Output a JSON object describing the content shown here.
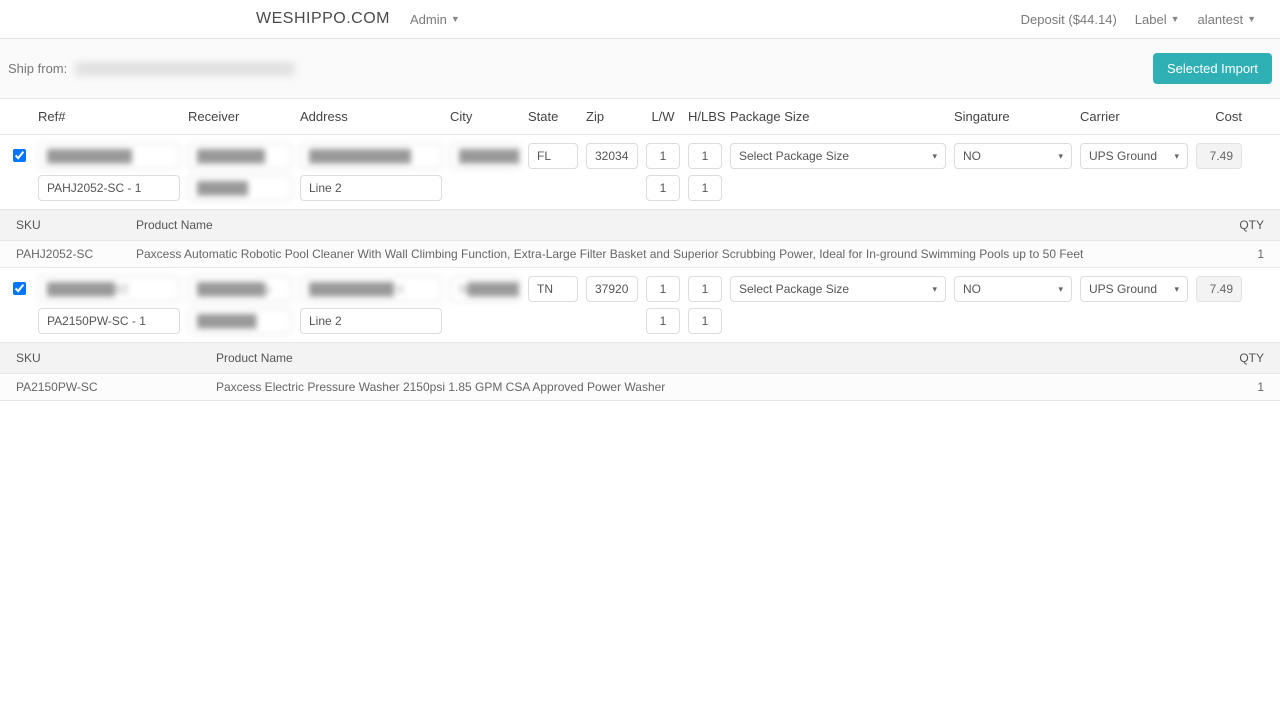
{
  "nav": {
    "brand": "WESHIPPO.COM",
    "admin": "Admin",
    "deposit": "Deposit ($44.14)",
    "label": "Label",
    "user": "alantest"
  },
  "toolbar": {
    "ship_from_label": "Ship from:",
    "selected_import": "Selected Import"
  },
  "columns": {
    "ref": "Ref#",
    "receiver": "Receiver",
    "address": "Address",
    "city": "City",
    "state": "State",
    "zip": "Zip",
    "lw": "L/W",
    "hlbs": "H/LBS",
    "package": "Package Size",
    "signature": "Singature",
    "carrier": "Carrier",
    "cost": "Cost"
  },
  "sub_columns": {
    "sku": "SKU",
    "name": "Product Name",
    "qty": "QTY"
  },
  "select_labels": {
    "package_placeholder": "Select Package Size",
    "sig_no": "NO",
    "carrier_ups": "UPS Ground"
  },
  "orders": [
    {
      "checked": true,
      "ref_masked": "██████████",
      "ref2": "PAHJ2052-SC - 1",
      "receiver_masked": "████████",
      "receiver2_masked": "██████",
      "addr_masked": "████████████",
      "addr2": "Line 2",
      "city_masked": "████████E",
      "state": "FL",
      "zip": "32034",
      "l": "1",
      "w": "1",
      "h": "1",
      "lbs": "1",
      "cost": "7.49",
      "items": [
        {
          "sku": "PAHJ2052-SC",
          "name": "Paxcess Automatic Robotic Pool Cleaner With Wall Climbing Function, Extra-Large Filter Basket and Superior Scrubbing Power, Ideal for In-ground Swimming Pools up to 50 Feet",
          "qty": "1"
        }
      ]
    },
    {
      "checked": true,
      "ref_masked": "████████42",
      "ref2": "PA2150PW-SC - 1",
      "receiver_masked": "████████y",
      "receiver2_masked": "███████",
      "addr_masked": "██████████ ir",
      "addr2": "Line 2",
      "city_masked": "N██████",
      "state": "TN",
      "zip": "37920",
      "l": "1",
      "w": "1",
      "h": "1",
      "lbs": "1",
      "cost": "7.49",
      "items": [
        {
          "sku": "PA2150PW-SC",
          "name": "Paxcess Electric Pressure Washer 2150psi 1.85 GPM CSA Approved Power Washer",
          "qty": "1"
        }
      ]
    }
  ]
}
